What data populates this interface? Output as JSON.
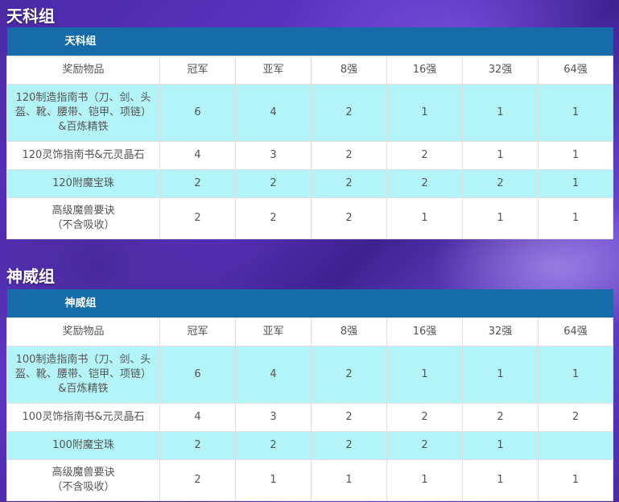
{
  "sections": [
    {
      "title": "天科组",
      "table_caption": "天科组",
      "columns": [
        "奖励物品",
        "冠军",
        "亚军",
        "8强",
        "16强",
        "32强",
        "64强"
      ],
      "rows": [
        {
          "item": "120制造指南书（刀、剑、头\n盔、靴、腰带、铠甲、项链）\n&百炼精铁",
          "values": [
            "6",
            "4",
            "2",
            "1",
            "1",
            "1"
          ]
        },
        {
          "item": "120灵饰指南书&元灵晶石",
          "values": [
            "4",
            "3",
            "2",
            "2",
            "1",
            "1"
          ]
        },
        {
          "item": "120附魔宝珠",
          "values": [
            "2",
            "2",
            "2",
            "2",
            "2",
            "1"
          ]
        },
        {
          "item": "高级魔兽要诀\n（不含吸收）",
          "values": [
            "2",
            "2",
            "2",
            "1",
            "1",
            "1"
          ]
        }
      ]
    },
    {
      "title": "神威组",
      "table_caption": "神威组",
      "columns": [
        "奖励物品",
        "冠军",
        "亚军",
        "8强",
        "16强",
        "32强",
        "64强"
      ],
      "rows": [
        {
          "item": "100制造指南书（刀、剑、头\n盔、靴、腰带、铠甲、项链）\n&百炼精铁",
          "values": [
            "6",
            "4",
            "2",
            "1",
            "1",
            "1"
          ]
        },
        {
          "item": "100灵饰指南书&元灵晶石",
          "values": [
            "4",
            "3",
            "2",
            "2",
            "2",
            "2"
          ]
        },
        {
          "item": "100附魔宝珠",
          "values": [
            "2",
            "2",
            "2",
            "2",
            "1",
            ""
          ]
        },
        {
          "item": "高级魔兽要诀\n（不含吸收）",
          "values": [
            "2",
            "1",
            "1",
            "1",
            "1",
            "1"
          ]
        }
      ]
    }
  ]
}
